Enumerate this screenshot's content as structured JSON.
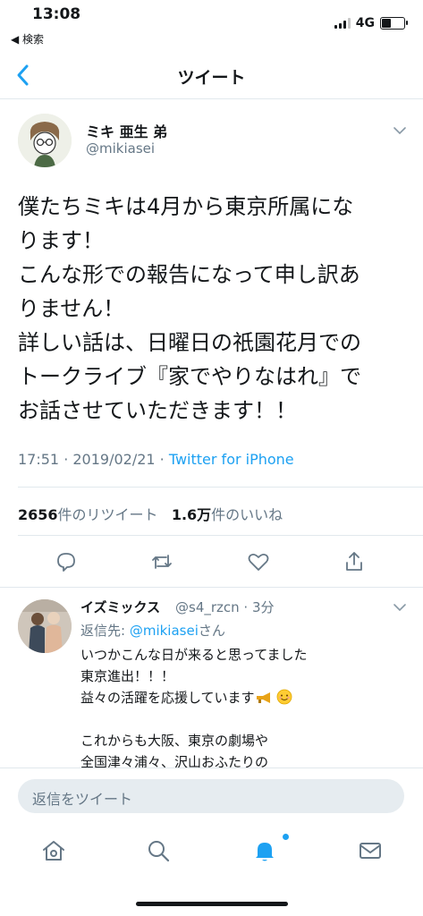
{
  "status_bar": {
    "time": "13:08",
    "back_label": "◀ 検索",
    "network": "4G"
  },
  "nav": {
    "title": "ツイート",
    "back_icon": "chevron-left-icon"
  },
  "tweet": {
    "display_name": "ミキ 亜生 弟",
    "handle": "@mikiasei",
    "text_lines": [
      "僕たちミキは4月から東京所属にな",
      "ります！",
      "こんな形での報告になって申し訳あ",
      "りません！",
      "詳しい話は、日曜日の祇園花月での",
      "トークライブ『家でやりなはれ』で",
      "お話させていただきます！！"
    ],
    "timestamp": "17:51 · 2019/02/21 · ",
    "source": "Twitter for iPhone",
    "retweet_count": "2656",
    "retweet_label": "件のリツイート",
    "like_count": "1.6万",
    "like_label": "件のいいね"
  },
  "actions": [
    "reply-icon",
    "retweet-icon",
    "like-icon",
    "share-icon"
  ],
  "reply": {
    "display_name": "イズミックス",
    "handle_time": "@s4_rzcn · 3分",
    "reply_prefix": "返信先: ",
    "reply_to": "@mikiasei",
    "reply_suffix": "さん",
    "lines": [
      "いつかこんな日が来ると思ってました",
      "東京進出！！！",
      "益々の活躍を応援しています",
      "",
      "これからも大阪、東京の劇場や",
      "全国津々浦々、沢山おふたりの"
    ]
  },
  "compose": {
    "placeholder": "返信をツイート"
  },
  "tabbar": [
    "home-icon",
    "search-icon",
    "notifications-icon",
    "messages-icon"
  ],
  "colors": {
    "accent": "#1da1f2",
    "secondary_text": "#657786",
    "divider": "#e1e8ed"
  }
}
